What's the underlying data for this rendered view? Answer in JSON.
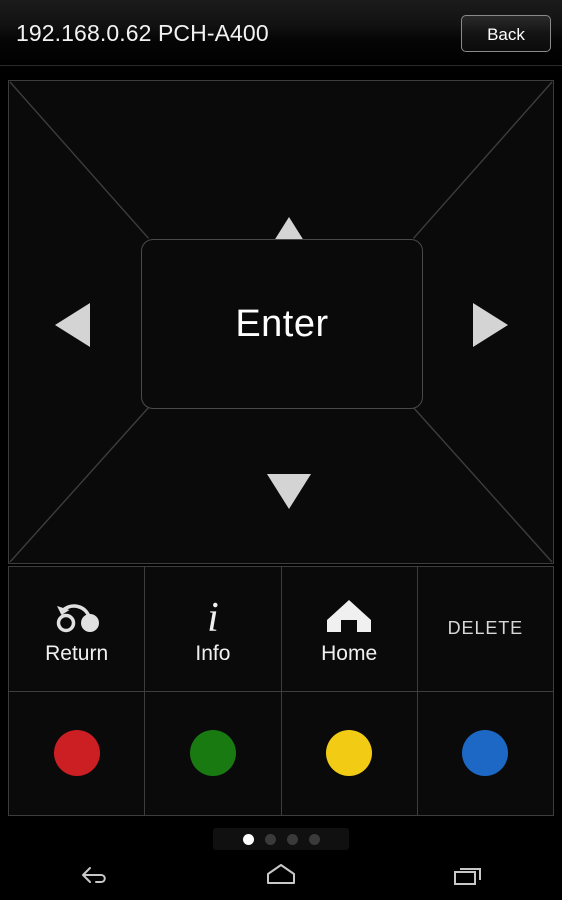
{
  "titlebar": {
    "title": "192.168.0.62 PCH-A400",
    "back_label": "Back"
  },
  "dpad": {
    "enter_label": "Enter",
    "up_icon": "triangle-up-icon",
    "down_icon": "triangle-down-icon",
    "left_icon": "triangle-left-icon",
    "right_icon": "triangle-right-icon"
  },
  "functions": [
    {
      "label": "Return",
      "icon": "return-arrow-icon"
    },
    {
      "label": "Info",
      "icon": "info-italic-i-icon"
    },
    {
      "label": "Home",
      "icon": "house-icon"
    },
    {
      "label": "DELETE",
      "icon": ""
    }
  ],
  "color_buttons": [
    {
      "name": "red",
      "color": "#cc1f24"
    },
    {
      "name": "green",
      "color": "#1a7a12"
    },
    {
      "name": "yellow",
      "color": "#f2cc14"
    },
    {
      "name": "blue",
      "color": "#1c68c4"
    }
  ],
  "page_indicator": {
    "total": 4,
    "active_index": 0
  },
  "navbar": {
    "back_icon": "android-back-icon",
    "home_icon": "android-home-icon",
    "recents_icon": "android-recents-icon"
  },
  "colors": {
    "background": "#000000",
    "panel": "#0a0a0a",
    "border": "#3d3d3d",
    "arrow": "#d4d4d4",
    "text": "#f2f2f2"
  }
}
